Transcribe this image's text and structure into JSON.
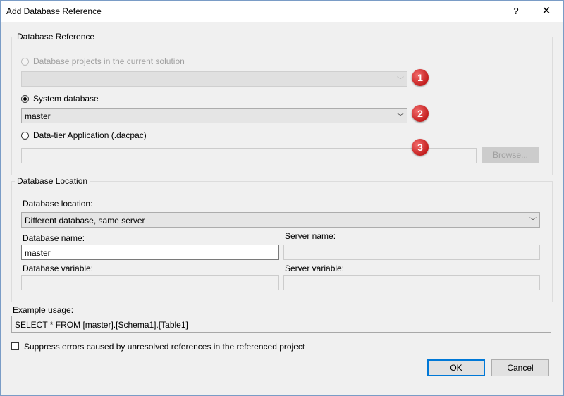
{
  "window": {
    "title": "Add Database Reference",
    "help": "?",
    "close": "✕"
  },
  "reference_group": {
    "label": "Database Reference",
    "option_projects": "Database projects in the current solution",
    "projects_value": "",
    "option_system": "System database",
    "system_value": "master",
    "option_dacpac": "Data-tier Application (.dacpac)",
    "dacpac_path": "",
    "browse_label": "Browse..."
  },
  "badges": [
    "1",
    "2",
    "3"
  ],
  "location_group": {
    "label": "Database Location",
    "location_label": "Database location:",
    "location_value": "Different database, same server",
    "db_name_label": "Database name:",
    "db_name_value": "master",
    "server_name_label": "Server name:",
    "db_var_label": "Database variable:",
    "server_var_label": "Server variable:"
  },
  "example": {
    "label": "Example usage:",
    "value": "SELECT * FROM [master].[Schema1].[Table1]"
  },
  "suppress_label": "Suppress errors caused by unresolved references in the referenced project",
  "buttons": {
    "ok": "OK",
    "cancel": "Cancel"
  },
  "colors": {
    "accent": "#0078d7",
    "badge": "#d42a2a"
  }
}
